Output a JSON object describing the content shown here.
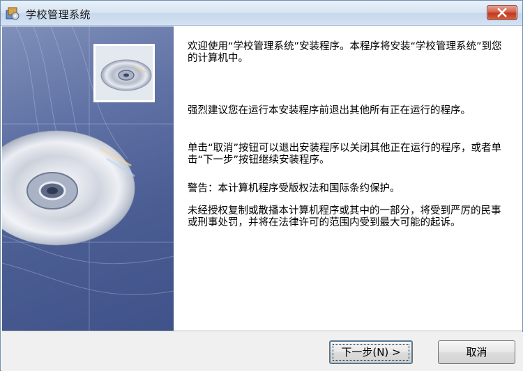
{
  "window": {
    "title": "学校管理系统",
    "close_label": "x"
  },
  "content": {
    "p1": "欢迎使用“学校管理系统”安装程序。本程序将安装“学校管理系统”到您的计算机中。",
    "p2": "强烈建议您在运行本安装程序前退出其他所有正在运行的程序。",
    "p3": "单击“取消”按钮可以退出安装程序以关闭其他正在运行的程序，或者单击“下一步”按钮继续安装程序。",
    "p4": "警告：本计算机程序受版权法和国际条约保护。",
    "p5": "未经授权复制或散播本计算机程序或其中的一部分，将受到严厉的民事或刑事处罚，并将在法律许可的范围内受到最大可能的起诉。"
  },
  "buttons": {
    "next_label": "下一步(N) >",
    "cancel_label": "取消"
  },
  "colors": {
    "banner": "#4a5d93",
    "close_button": "#c2391f",
    "title_bar": "#d7e4f2"
  },
  "icons": {
    "app": "installer-icon",
    "close": "close-icon",
    "disc": "cd-disc-icon"
  }
}
